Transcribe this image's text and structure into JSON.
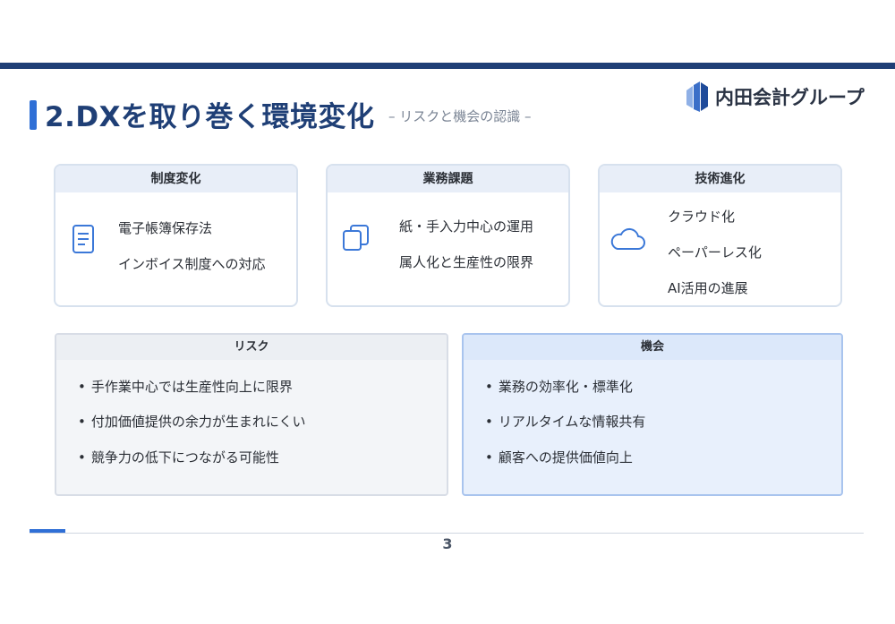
{
  "header": {
    "title": "2.DXを取り巻く環境変化",
    "subtitle": "– リスクと機会の認識 –",
    "logo_text": "内田会計グループ",
    "accent_color": "#1f3f76"
  },
  "cards": [
    {
      "title": "制度変化",
      "icon": "document-icon",
      "items": [
        "電子帳簿保存法",
        "インボイス制度への対応"
      ]
    },
    {
      "title": "業務課題",
      "icon": "copy-icon",
      "items": [
        "紙・手入力中心の運用",
        "属人化と生産性の限界"
      ]
    },
    {
      "title": "技術進化",
      "icon": "cloud-icon",
      "items": [
        "クラウド化",
        "ペーパーレス化",
        "AI活用の進展"
      ]
    }
  ],
  "risk": {
    "title": "リスク",
    "items": [
      "手作業中心では生産性向上に限界",
      "付加価値提供の余力が生まれにくい",
      "競争力の低下につながる可能性"
    ]
  },
  "opportunity": {
    "title": "機会",
    "items": [
      "業務の効率化・標準化",
      "リアルタイムな情報共有",
      "顧客への提供価値向上"
    ]
  },
  "footer": {
    "page_number": "3"
  }
}
